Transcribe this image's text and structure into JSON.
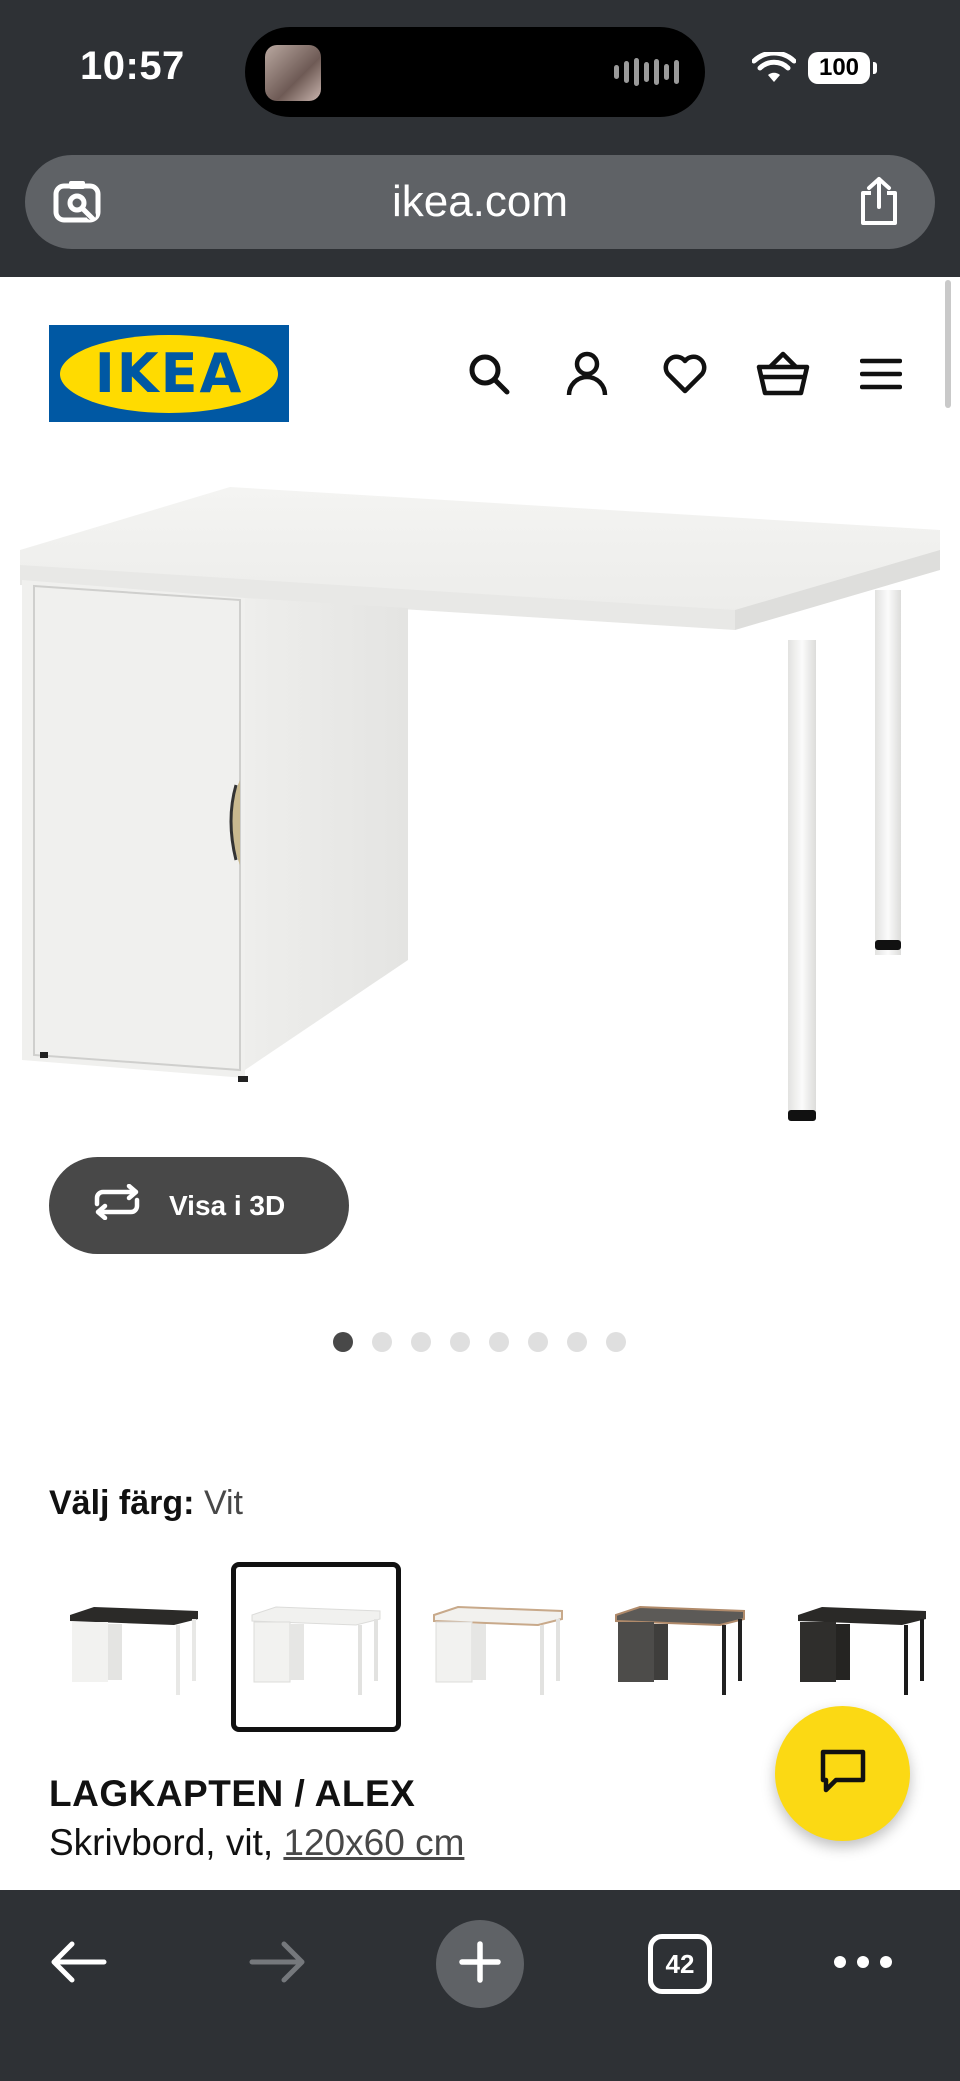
{
  "status_bar": {
    "time": "10:57",
    "battery": "100"
  },
  "browser": {
    "url": "ikea.com",
    "tab_count": "42"
  },
  "header": {
    "logo_text": "IKEA",
    "icons": [
      "search-icon",
      "account-icon",
      "heart-icon",
      "basket-icon",
      "menu-icon"
    ]
  },
  "gallery": {
    "view_3d_label": "Visa i 3D",
    "image_count": 8,
    "active_index": 0
  },
  "color_picker": {
    "label": "Välj färg:",
    "selected_value": "Vit",
    "swatches": [
      {
        "name": "black-brown top / white cabinet",
        "selected": false
      },
      {
        "name": "white",
        "selected": true
      },
      {
        "name": "white / birch edge",
        "selected": false
      },
      {
        "name": "dark grey",
        "selected": false
      },
      {
        "name": "black-brown",
        "selected": false
      }
    ]
  },
  "product": {
    "name": "LAGKAPTEN / ALEX",
    "description_prefix": "Skrivbord, vit, ",
    "size_link": "120x60 cm"
  },
  "colors": {
    "chrome": "#2e3135",
    "ikea_blue": "#0058a3",
    "ikea_yellow": "#ffdb00",
    "chat_yellow": "#fbd914",
    "button_dark": "#484848"
  }
}
